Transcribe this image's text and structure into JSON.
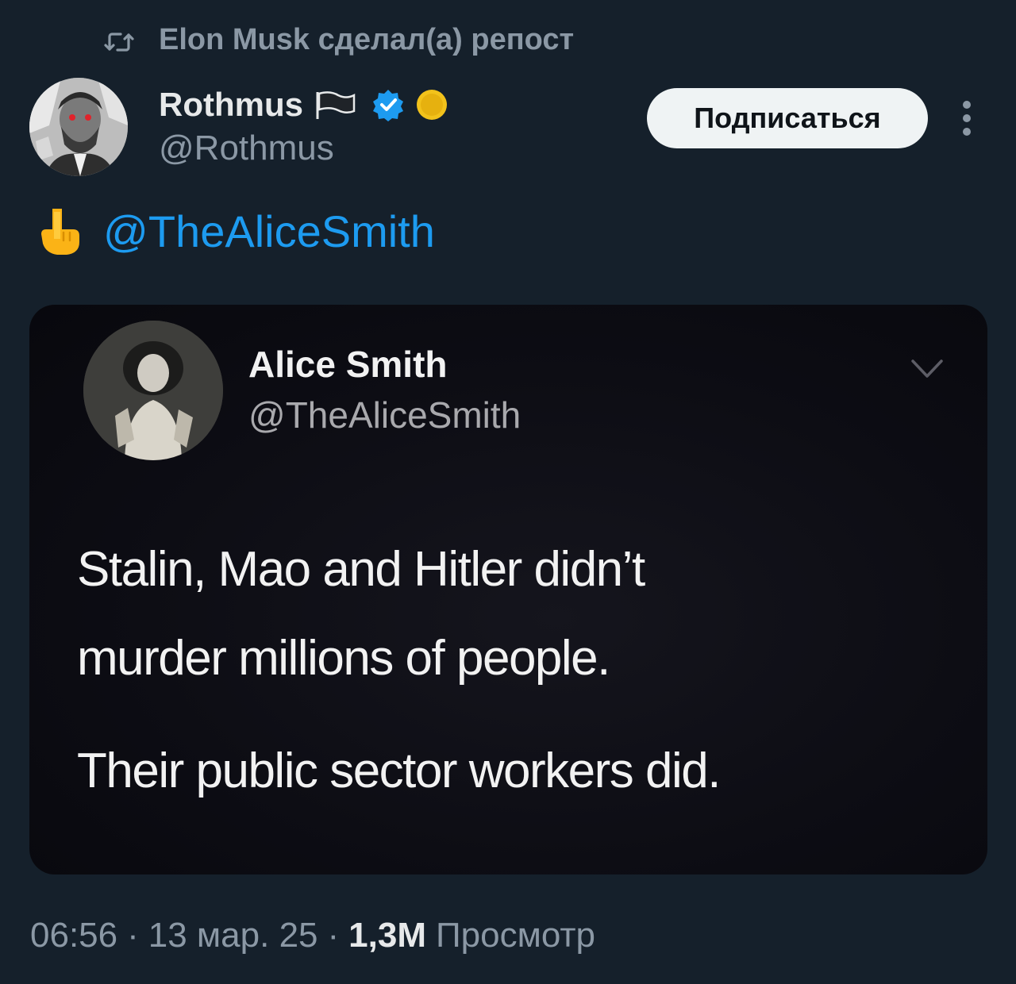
{
  "repost": {
    "icon": "repost-icon",
    "text": "Elon Musk сделал(а) репост"
  },
  "author": {
    "name": "Rothmus",
    "handle": "@Rothmus",
    "badges": [
      "flag-icon",
      "verified-icon",
      "coin-icon"
    ],
    "verified_color": "#1d9bf0",
    "coin_color": "#f2c21b"
  },
  "actions": {
    "follow_label": "Подписаться",
    "more_icon": "more-icon"
  },
  "tweet": {
    "emoji": "pointing-down-icon",
    "mention": "@TheAliceSmith"
  },
  "quoted_image": {
    "name": "Alice Smith",
    "handle": "@TheAliceSmith",
    "chevron_icon": "chevron-down-icon",
    "line1": "Stalin, Mao and Hitler didn’t",
    "line2": "murder millions of people.",
    "line3": "Their public sector workers did."
  },
  "meta": {
    "time": "06:56",
    "separator": "·",
    "date": "13 мар. 25",
    "views_count": "1,3M",
    "views_label": "Просмотр"
  },
  "colors": {
    "background": "#15202b",
    "text_primary": "#e7e9ea",
    "text_secondary": "#8b98a5",
    "link": "#1d9bf0",
    "button_bg": "#eff3f4"
  }
}
